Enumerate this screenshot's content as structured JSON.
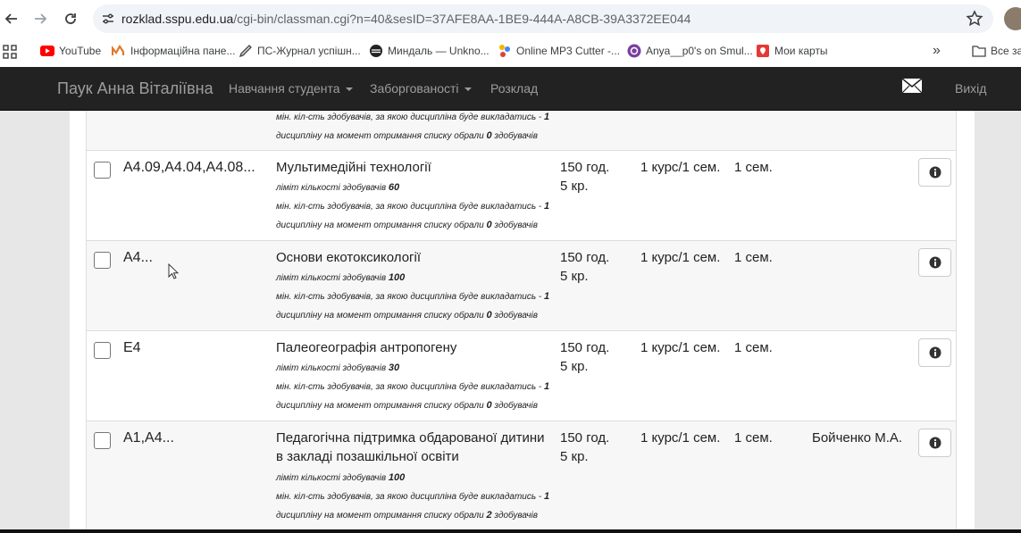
{
  "browser": {
    "url_host": "rozklad.sspu.edu.ua",
    "url_path": "/cgi-bin/classman.cgi?n=40&sesID=37AFE8AA-1BE9-444A-A8CB-39A3372EE044"
  },
  "bookmarks": [
    {
      "label": "YouTube",
      "icon": "youtube-icon"
    },
    {
      "label": "Інформаційна пане...",
      "icon": "m-logo-icon"
    },
    {
      "label": "ПС-Журнал успішн...",
      "icon": "pen-icon"
    },
    {
      "label": "Миндаль — Unkno...",
      "icon": "music-icon"
    },
    {
      "label": "Online MP3 Cutter -...",
      "icon": "dots-icon"
    },
    {
      "label": "Anya__p0's on Smul...",
      "icon": "smule-icon"
    },
    {
      "label": "Мои карты",
      "icon": "map-pin-icon"
    }
  ],
  "bookmarks_more": "»",
  "bookmarks_all": "Все за",
  "navbar": {
    "brand": "Паук Анна Віталіївна",
    "items": [
      "Навчання студента",
      "Заборгованості",
      "Розклад"
    ],
    "logout": "Вихід"
  },
  "colors": {
    "navbar_bg": "#222222",
    "navbar_text": "#9d9d9d",
    "youtube_red": "#ff0000"
  },
  "top_partial_row": {
    "min_prefix": "мін. кіл-сть здобувачів, за якою дисципліна буде викладатись - ",
    "min_value": "1",
    "chosen_prefix": "дисципліну на момент отримання списку обрали ",
    "chosen_value": "0",
    "chosen_suffix": " здобувачів"
  },
  "rows": [
    {
      "code": "А4.09,А4.04,А4.08...",
      "title": "Мультимедійні технології",
      "title2": "",
      "limit_prefix": "ліміт кількості здобувачів ",
      "limit_value": "60",
      "min_prefix": "мін. кіл-сть здобувачів, за якою дисципліна буде викладатись - ",
      "min_value": "1",
      "chosen_prefix": "дисципліну на момент отримання списку обрали ",
      "chosen_value": "0",
      "chosen_suffix": " здобувачів",
      "hours": "150 год.",
      "credits": "5 кр.",
      "course": "1 курс/1 сем.",
      "sem": "1 сем.",
      "teacher": ""
    },
    {
      "code": "А4...",
      "title": "Основи екотоксикології",
      "title2": "",
      "limit_prefix": "ліміт кількості здобувачів ",
      "limit_value": "100",
      "min_prefix": "мін. кіл-сть здобувачів, за якою дисципліна буде викладатись - ",
      "min_value": "1",
      "chosen_prefix": "дисципліну на момент отримання списку обрали ",
      "chosen_value": "0",
      "chosen_suffix": " здобувачів",
      "hours": "150 год.",
      "credits": "5 кр.",
      "course": "1 курс/1 сем.",
      "sem": "1 сем.",
      "teacher": ""
    },
    {
      "code": "Е4",
      "title": "Палеогеографія антропогену",
      "title2": "",
      "limit_prefix": "ліміт кількості здобувачів ",
      "limit_value": "30",
      "min_prefix": "мін. кіл-сть здобувачів, за якою дисципліна буде викладатись - ",
      "min_value": "1",
      "chosen_prefix": "дисципліну на момент отримання списку обрали ",
      "chosen_value": "0",
      "chosen_suffix": " здобувачів",
      "hours": "150 год.",
      "credits": "5 кр.",
      "course": "1 курс/1 сем.",
      "sem": "1 сем.",
      "teacher": ""
    },
    {
      "code": "А1,А4...",
      "title": "Педагогічна підтримка обдарованої дитини",
      "title2": "в закладі позашкільної освіти",
      "limit_prefix": "ліміт кількості здобувачів ",
      "limit_value": "100",
      "min_prefix": "мін. кіл-сть здобувачів, за якою дисципліна буде викладатись - ",
      "min_value": "1",
      "chosen_prefix": "дисципліну на момент отримання списку обрали ",
      "chosen_value": "2",
      "chosen_suffix": " здобувачів",
      "hours": "150 год.",
      "credits": "5 кр.",
      "course": "1 курс/1 сем.",
      "sem": "1 сем.",
      "teacher": "Бойченко М.А."
    }
  ]
}
